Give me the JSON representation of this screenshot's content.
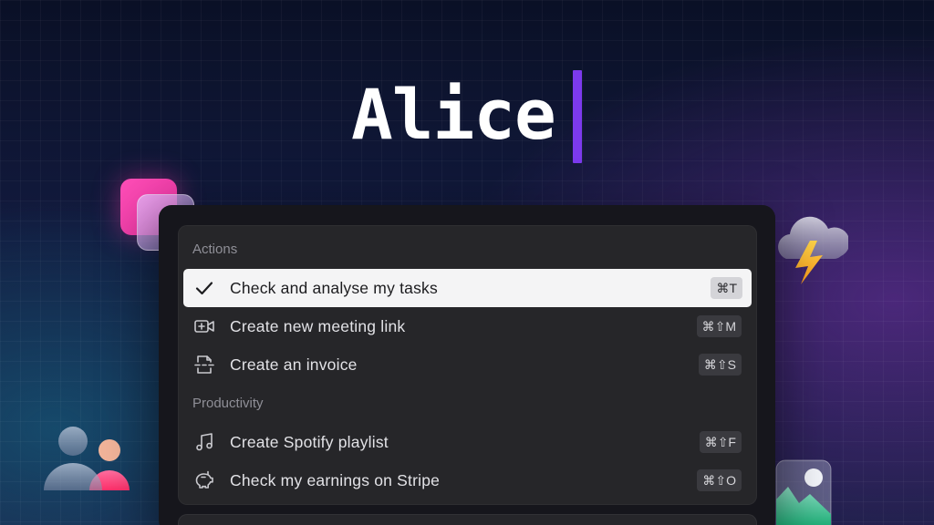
{
  "hero": {
    "title": "Alice"
  },
  "palette": {
    "sections": [
      {
        "label": "Actions",
        "items": [
          {
            "label": "Check and analyse my tasks",
            "shortcut": "⌘T",
            "icon": "checkmark-icon",
            "selected": true
          },
          {
            "label": "Create new meeting link",
            "shortcut": "⌘⇧M",
            "icon": "video-plus-icon"
          },
          {
            "label": "Create an invoice",
            "shortcut": "⌘⇧S",
            "icon": "document-scan-icon"
          }
        ]
      },
      {
        "label": "Productivity",
        "items": [
          {
            "label": "Create Spotify playlist",
            "shortcut": "⌘⇧F",
            "icon": "music-note-icon"
          },
          {
            "label": "Check my earnings on Stripe",
            "shortcut": "⌘⇧O",
            "icon": "piggy-bank-icon"
          }
        ]
      }
    ]
  },
  "colors": {
    "cursor_accent": "#7c3aed",
    "selected_row": "#f4f4f5",
    "panel": "#262629",
    "pink_square": "#ff4fb8"
  }
}
